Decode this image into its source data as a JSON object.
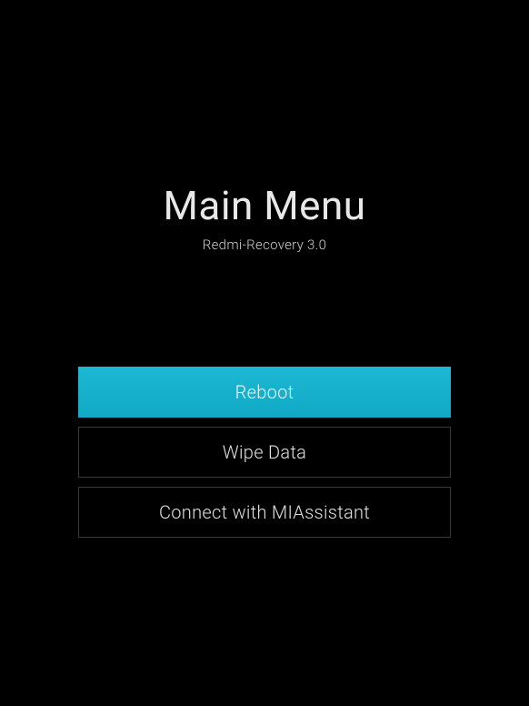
{
  "header": {
    "title": "Main Menu",
    "subtitle": "Redmi-Recovery 3.0"
  },
  "menu": {
    "items": [
      {
        "label": "Reboot",
        "selected": true
      },
      {
        "label": "Wipe Data",
        "selected": false
      },
      {
        "label": "Connect with MIAssistant",
        "selected": false
      }
    ]
  }
}
